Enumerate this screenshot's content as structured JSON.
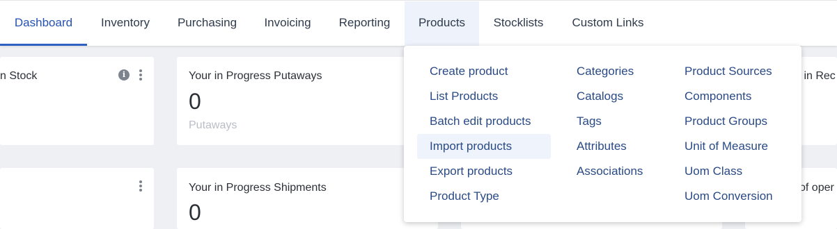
{
  "nav": {
    "tabs": [
      {
        "label": "Dashboard"
      },
      {
        "label": "Inventory"
      },
      {
        "label": "Purchasing"
      },
      {
        "label": "Invoicing"
      },
      {
        "label": "Reporting"
      },
      {
        "label": "Products"
      },
      {
        "label": "Stocklists"
      },
      {
        "label": "Custom Links"
      }
    ],
    "active_tab": "Dashboard",
    "open_tab": "Products"
  },
  "cards": {
    "stock": {
      "title": "n Stock"
    },
    "putaways": {
      "title": "Your in Progress Putaways",
      "value": "0",
      "sub": "Putaways"
    },
    "receipts": {
      "title": "s in Rec"
    },
    "empty": {},
    "shipments": {
      "title": "Your in Progress Shipments",
      "value": "0"
    },
    "operations": {
      "title": "of oper"
    }
  },
  "products_menu": {
    "col1": [
      "Create product",
      "List Products",
      "Batch edit products",
      "Import products",
      "Export products",
      "Product Type"
    ],
    "col2": [
      "Categories",
      "Catalogs",
      "Tags",
      "Attributes",
      "Associations"
    ],
    "col3": [
      "Product Sources",
      "Components",
      "Product Groups",
      "Unit of Measure",
      "Uom Class",
      "Uom Conversion"
    ],
    "highlighted": "Import products"
  },
  "colors": {
    "accent": "#2e5fc2",
    "menu_text": "#2a4a86",
    "highlight_bg": "#eef3fc"
  }
}
